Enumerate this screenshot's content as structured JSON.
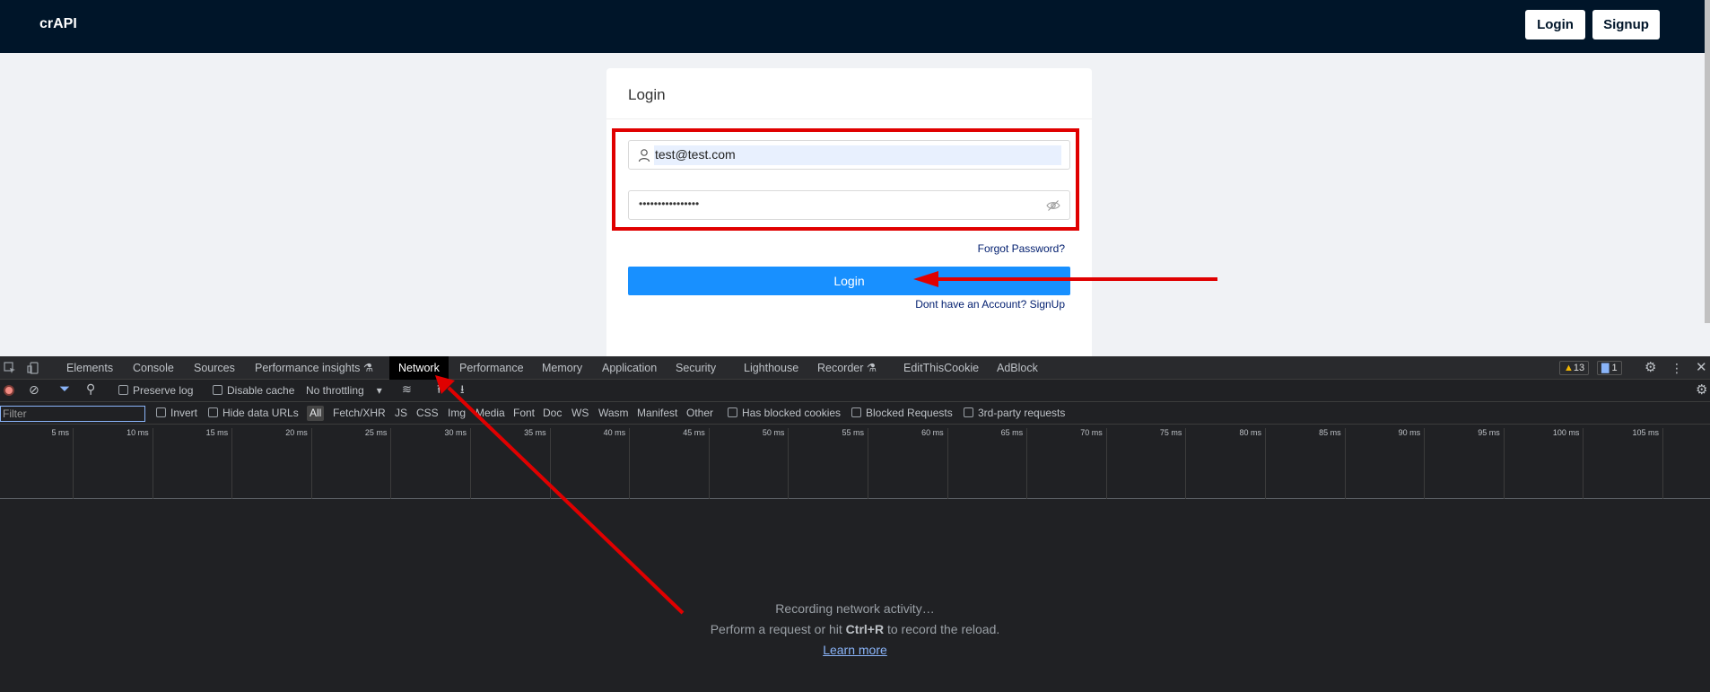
{
  "site": {
    "brand": "crAPI",
    "nav_login": "Login",
    "nav_signup": "Signup",
    "card_title": "Login",
    "email_value": "test@test.com",
    "password_mask": "••••••••••••••••",
    "forgot": "Forgot Password?",
    "login_button": "Login",
    "signup_link": "Dont have an Account? SignUp"
  },
  "devtools": {
    "tabs": [
      "Elements",
      "Console",
      "Sources",
      "Performance insights",
      "Network",
      "Performance",
      "Memory",
      "Application",
      "Security",
      "Lighthouse",
      "Recorder",
      "EditThisCookie",
      "AdBlock"
    ],
    "active_tab": "Network",
    "warnings": "13",
    "messages": "1",
    "toolbar": {
      "preserve_log": "Preserve log",
      "disable_cache": "Disable cache",
      "throttling": "No throttling"
    },
    "filter": {
      "placeholder": "Filter",
      "invert": "Invert",
      "hide_data_urls": "Hide data URLs",
      "types": [
        "All",
        "Fetch/XHR",
        "JS",
        "CSS",
        "Img",
        "Media",
        "Font",
        "Doc",
        "WS",
        "Wasm",
        "Manifest",
        "Other"
      ],
      "has_blocked_cookies": "Has blocked cookies",
      "blocked_requests": "Blocked Requests",
      "third_party": "3rd-party requests"
    },
    "timeline_ticks": [
      "5 ms",
      "10 ms",
      "15 ms",
      "20 ms",
      "25 ms",
      "30 ms",
      "35 ms",
      "40 ms",
      "45 ms",
      "50 ms",
      "55 ms",
      "60 ms",
      "65 ms",
      "70 ms",
      "75 ms",
      "80 ms",
      "85 ms",
      "90 ms",
      "95 ms",
      "100 ms",
      "105 ms"
    ],
    "empty": {
      "recording": "Recording network activity…",
      "hint_pre": "Perform a request or hit ",
      "hint_key": "Ctrl+R",
      "hint_post": " to record the reload.",
      "learn_more": "Learn more"
    }
  },
  "colors": {
    "navbar": "#001529",
    "primary": "#1890ff",
    "annotation": "#e00000",
    "devtools_bg": "#202124"
  }
}
